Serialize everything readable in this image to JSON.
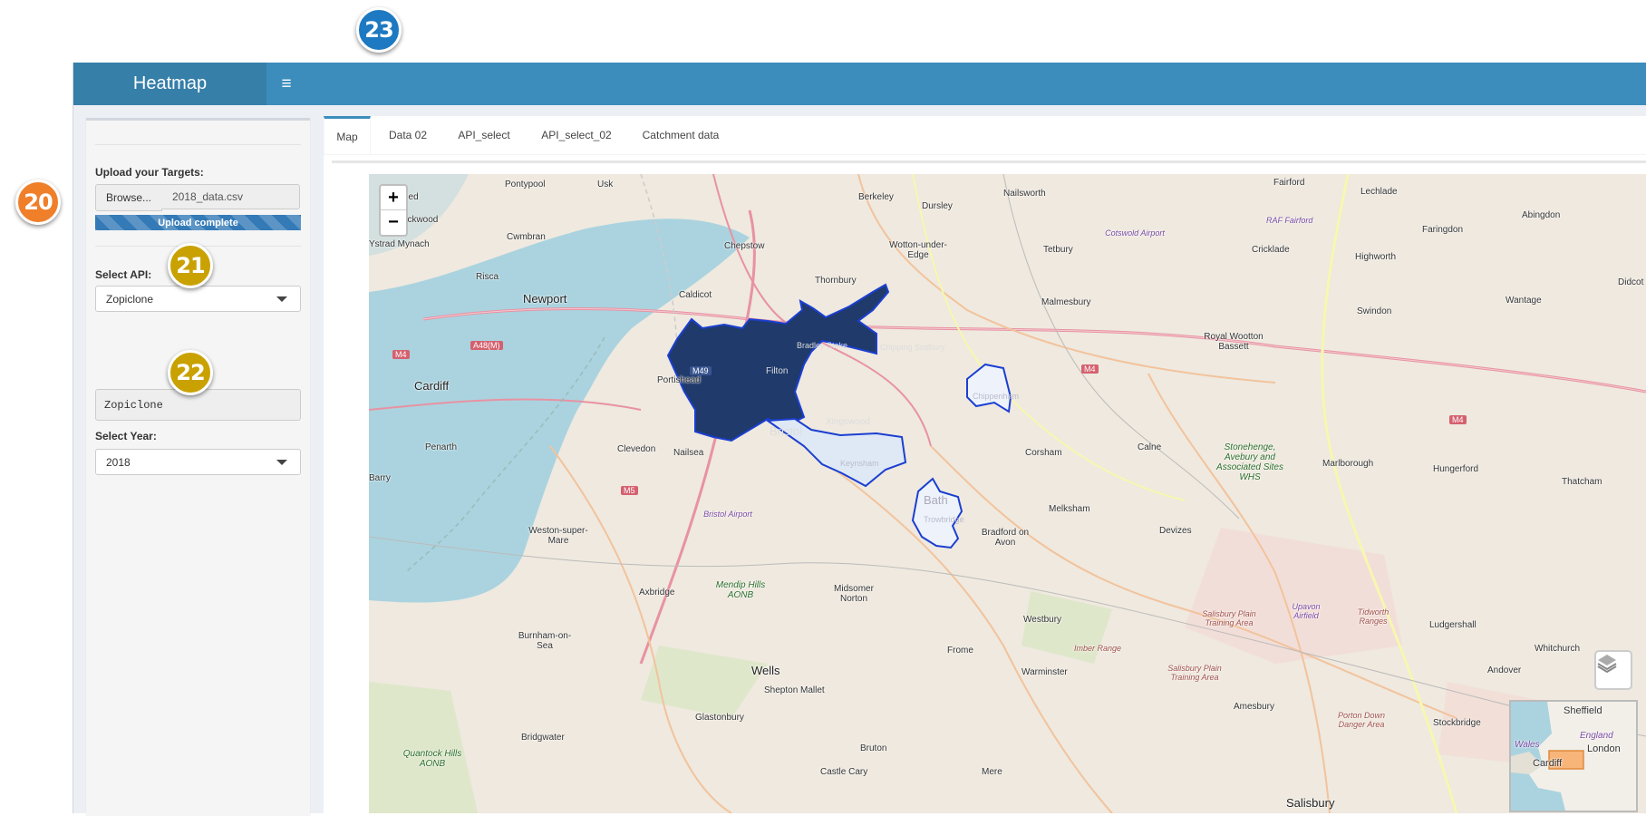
{
  "callouts": {
    "c20": "20",
    "c21": "21",
    "c22": "22",
    "c23": "23"
  },
  "colors": {
    "header": "#3c8dbc",
    "logo_bg": "#367fa9",
    "callout_orange": "#f07f2a",
    "callout_gold": "#c9a100",
    "callout_blue": "#1d79c1",
    "heat_dark": "#1f3a6b",
    "heat_light": "#dfe9f5",
    "heat_outline": "#1b3fd1"
  },
  "header": {
    "title": "Heatmap",
    "toggle_icon": "≡"
  },
  "sidebar": {
    "upload_label": "Upload your Targets:",
    "browse_label": "Browse...",
    "file_name": "2018_data.csv",
    "progress_text": "Upload complete",
    "progress_fraction": 1.0,
    "api_label": "Select API:",
    "api_value": "Zopiclone",
    "api_text_output": "Zopiclone",
    "year_label": "Select Year:",
    "year_value": "2018"
  },
  "tabs": [
    {
      "label": "Map",
      "active": true
    },
    {
      "label": "Data 02",
      "active": false
    },
    {
      "label": "API_select",
      "active": false
    },
    {
      "label": "API_select_02",
      "active": false
    },
    {
      "label": "Catchment data",
      "active": false
    }
  ],
  "map": {
    "zoom_in": "+",
    "zoom_out": "−",
    "layers_icon": "layers-icon",
    "places": {
      "pontypool": "Pontypool",
      "usk": "Usk",
      "berkeley": "Berkeley",
      "nailsworth": "Nailsworth",
      "fairford": "Fairford",
      "lechlade": "Lechlade",
      "blackwood": "Blackwood",
      "wood": "oed",
      "dursley": "Dursley",
      "raf_fairford": "RAF Fairford",
      "cotswold_airport": "Cotswold Airport",
      "faringdon": "Faringdon",
      "abingdon": "Abingdon",
      "ystrad": "Ystrad Mynach",
      "cwmbran": "Cwmbran",
      "chepstow": "Chepstow",
      "wotton": "Wotton-under-Edge",
      "tetbury": "Tetbury",
      "cricklade": "Cricklade",
      "highworth": "Highworth",
      "risca": "Risca",
      "thornbury": "Thornbury",
      "didcot": "Didcot",
      "newport": "Newport",
      "caldicot": "Caldicot",
      "malmesbury": "Malmesbury",
      "wantage": "Wantage",
      "royal_wootton": "Royal Wootton Bassett",
      "swindon": "Swindon",
      "cardiff": "Cardiff",
      "portishead": "Portishead",
      "bristol": "Bristol",
      "xingswood": "Xingswood",
      "corsham": "Corsham",
      "calne": "Calne",
      "penarth": "Penarth",
      "clevedon": "Clevedon",
      "nailsea": "Nailsea",
      "marlborough": "Marlborough",
      "hungerford": "Hungerford",
      "thatcham": "Thatcham",
      "stonehenge": "Stonehenge, Avebury and Associated Sites WHS",
      "barry": "Barry",
      "bath": "Bath",
      "melksham": "Melksham",
      "devizes": "Devizes",
      "bristol_airport": "Bristol Airport",
      "weston": "Weston-super-Mare",
      "bradford": "Bradford on Avon",
      "axbridge": "Axbridge",
      "mendip": "Mendip Hills AONB",
      "midsomer": "Midsomer Norton",
      "salisbury_plain1": "Salisbury Plain Training Area",
      "upavon": "Upavon Airfield",
      "tidworth": "Tidworth Ranges",
      "ludgershall": "Ludgershall",
      "westbury": "Westbury",
      "burnham": "Burnham-on-Sea",
      "imber": "Imber Range",
      "whitchurch": "Whitchurch",
      "wells": "Wells",
      "frome": "Frome",
      "warminster": "Warminster",
      "salisbury_plain2": "Salisbury Plain Training Area",
      "andover": "Andover",
      "shepton": "Shepton Mallet",
      "amesbury": "Amesbury",
      "stockbridge": "Stockbridge",
      "glastonbury": "Glastonbury",
      "porton": "Porton Down Danger Area",
      "bridgwater": "Bridgwater",
      "quantock": "Quantock Hills AONB",
      "bruton": "Bruton",
      "castle_cary": "Castle Cary",
      "mere": "Mere",
      "salisbury": "Salisbury",
      "m4": "M4",
      "m5": "M5",
      "m49": "M49",
      "a48": "A48(M)",
      "filton": "Filton",
      "chipping": "Chipping Sodbury",
      "bradley": "Bradley Stoke",
      "chippenham": "Chippenham",
      "trowbridge": "Trowbridge",
      "keynsham": "Keynsham"
    },
    "minimap": {
      "sheffield": "Sheffield",
      "england": "England",
      "wales": "Wales",
      "london": "London",
      "cardiff": "Cardiff"
    }
  }
}
